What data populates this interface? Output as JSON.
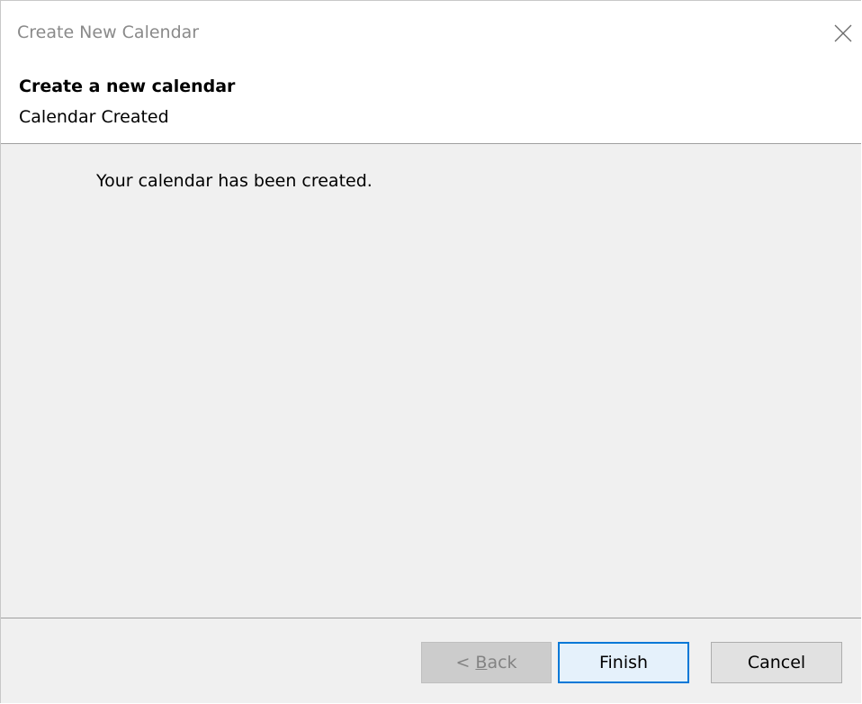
{
  "window": {
    "title": "Create New Calendar",
    "close_icon": "close-icon"
  },
  "header": {
    "title": "Create a new calendar",
    "subtitle": "Calendar Created"
  },
  "content": {
    "message": "Your calendar has been created."
  },
  "buttons": {
    "back": {
      "prefix": "< ",
      "accel": "B",
      "rest": "ack",
      "enabled": false
    },
    "finish": {
      "label": "Finish"
    },
    "cancel": {
      "label": "Cancel"
    }
  },
  "colors": {
    "focus_border": "#0078d7",
    "panel_bg": "#f0f0f0",
    "disabled_text": "#838383"
  }
}
